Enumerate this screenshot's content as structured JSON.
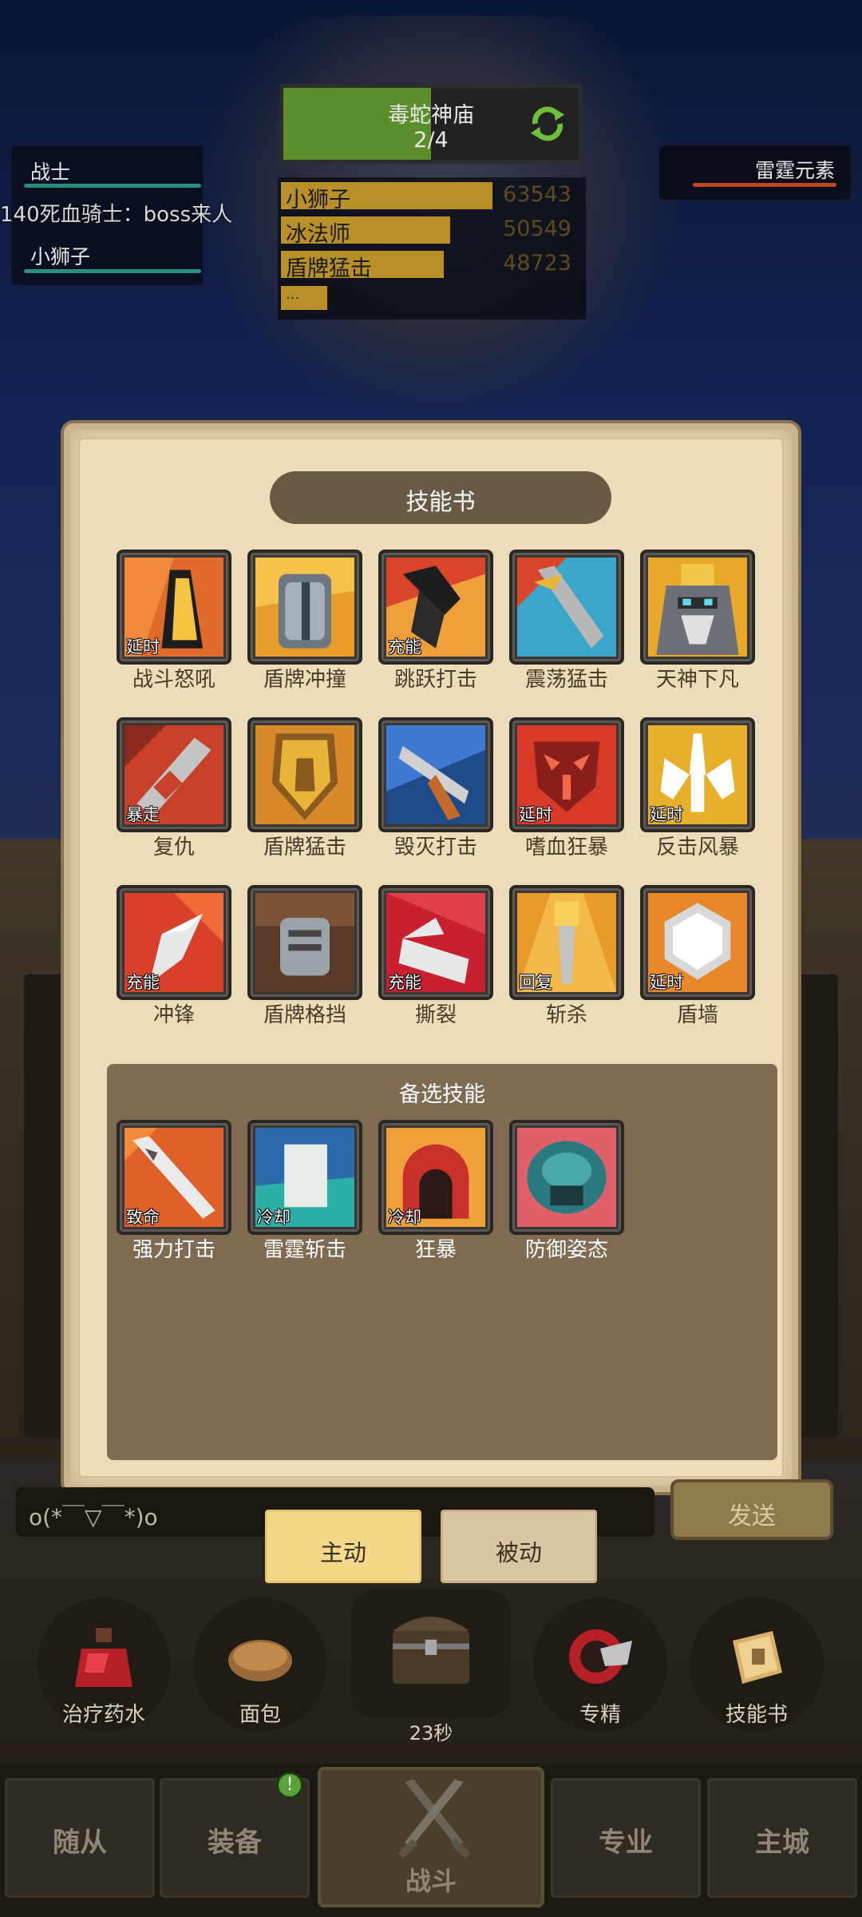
{
  "party": {
    "members": [
      "战士",
      "小狮子"
    ],
    "chat_line": "140死血骑士：boss来人"
  },
  "dungeon": {
    "name": "毒蛇神庙",
    "progress": "2/4",
    "progress_fraction": 0.5
  },
  "damage_ranking": [
    {
      "name": "小狮子",
      "value": "63543",
      "fraction": 0.7
    },
    {
      "name": "冰法师",
      "value": "50549",
      "fraction": 0.56
    },
    {
      "name": "盾牌猛击",
      "value": "48723",
      "fraction": 0.54
    }
  ],
  "damage_more": "...",
  "enemy": {
    "name": "雷霆元素"
  },
  "modal": {
    "title": "技能书",
    "skills": [
      {
        "name": "战斗怒吼",
        "tag": "延时",
        "icon": "war-cry-icon"
      },
      {
        "name": "盾牌冲撞",
        "tag": "",
        "icon": "shield-charge-icon"
      },
      {
        "name": "跳跃打击",
        "tag": "充能",
        "icon": "leap-strike-icon"
      },
      {
        "name": "震荡猛击",
        "tag": "",
        "icon": "shockwave-slam-icon"
      },
      {
        "name": "天神下凡",
        "tag": "",
        "icon": "avatar-icon"
      },
      {
        "name": "复仇",
        "tag": "暴走",
        "icon": "revenge-icon"
      },
      {
        "name": "盾牌猛击",
        "tag": "",
        "icon": "shield-slam-icon"
      },
      {
        "name": "毁灭打击",
        "tag": "",
        "icon": "devastate-icon"
      },
      {
        "name": "嗜血狂暴",
        "tag": "延时",
        "icon": "bloodlust-icon"
      },
      {
        "name": "反击风暴",
        "tag": "延时",
        "icon": "retaliation-icon"
      },
      {
        "name": "冲锋",
        "tag": "充能",
        "icon": "charge-icon"
      },
      {
        "name": "盾牌格挡",
        "tag": "",
        "icon": "shield-block-icon"
      },
      {
        "name": "撕裂",
        "tag": "充能",
        "icon": "rend-icon"
      },
      {
        "name": "斩杀",
        "tag": "回复",
        "icon": "execute-icon"
      },
      {
        "name": "盾墙",
        "tag": "延时",
        "icon": "shield-wall-icon"
      }
    ],
    "reserve_title": "备选技能",
    "reserve_skills": [
      {
        "name": "强力打击",
        "tag": "致命",
        "icon": "power-strike-icon"
      },
      {
        "name": "雷霆斩击",
        "tag": "冷却",
        "icon": "thunder-slash-icon"
      },
      {
        "name": "狂暴",
        "tag": "冷却",
        "icon": "berserk-icon"
      },
      {
        "name": "防御姿态",
        "tag": "",
        "icon": "defensive-stance-icon"
      }
    ]
  },
  "chat": {
    "text": "o(*￣▽￣*)o",
    "send": "发送"
  },
  "tabs": {
    "active": "主动",
    "passive": "被动"
  },
  "quick_items": [
    {
      "label": "治疗药水",
      "icon": "health-potion-icon"
    },
    {
      "label": "面包",
      "icon": "bread-icon"
    },
    {
      "label": "专精",
      "icon": "specialization-icon"
    },
    {
      "label": "技能书",
      "icon": "skill-book-icon"
    }
  ],
  "chest": {
    "timer": "23秒",
    "icon": "treasure-chest-icon"
  },
  "nav": {
    "followers": "随从",
    "equipment": "装备",
    "battle": "战斗",
    "profession": "专业",
    "main_city": "主城",
    "notification": "!"
  },
  "colors": {
    "modal_bg": "#ecdcb8",
    "reserve_bg": "#7f6a52",
    "active_tab": "#f5d98a",
    "damage_bar": "#b98f28",
    "dungeon_bar": "#5b8d2b"
  }
}
